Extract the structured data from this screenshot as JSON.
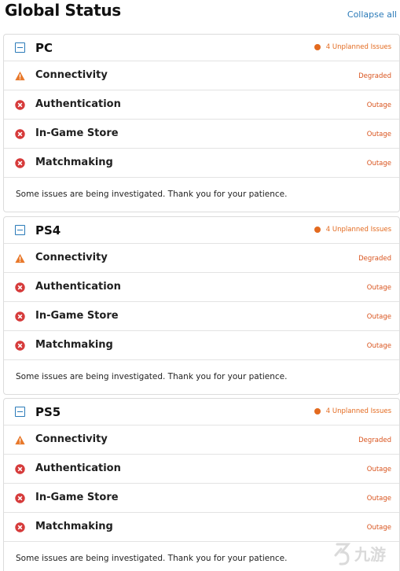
{
  "header": {
    "title": "Global Status",
    "collapse_all": "Collapse all"
  },
  "platforms": [
    {
      "name": "PC",
      "issues": "4 Unplanned Issues",
      "services": [
        {
          "name": "Connectivity",
          "status": "Degraded",
          "icon": "warning-icon"
        },
        {
          "name": "Authentication",
          "status": "Outage",
          "icon": "error-icon"
        },
        {
          "name": "In-Game Store",
          "status": "Outage",
          "icon": "error-icon"
        },
        {
          "name": "Matchmaking",
          "status": "Outage",
          "icon": "error-icon"
        }
      ],
      "note": "Some issues are being investigated. Thank you for your patience."
    },
    {
      "name": "PS4",
      "issues": "4 Unplanned Issues",
      "services": [
        {
          "name": "Connectivity",
          "status": "Degraded",
          "icon": "warning-icon"
        },
        {
          "name": "Authentication",
          "status": "Outage",
          "icon": "error-icon"
        },
        {
          "name": "In-Game Store",
          "status": "Outage",
          "icon": "error-icon"
        },
        {
          "name": "Matchmaking",
          "status": "Outage",
          "icon": "error-icon"
        }
      ],
      "note": "Some issues are being investigated. Thank you for your patience."
    },
    {
      "name": "PS5",
      "issues": "4 Unplanned Issues",
      "services": [
        {
          "name": "Connectivity",
          "status": "Degraded",
          "icon": "warning-icon"
        },
        {
          "name": "Authentication",
          "status": "Outage",
          "icon": "error-icon"
        },
        {
          "name": "In-Game Store",
          "status": "Outage",
          "icon": "error-icon"
        },
        {
          "name": "Matchmaking",
          "status": "Outage",
          "icon": "error-icon"
        }
      ],
      "note": "Some issues are being investigated. Thank you for your patience."
    }
  ],
  "watermark": {
    "text": "九游"
  },
  "colors": {
    "accent": "#2a7ab8",
    "warning": "#e8782a",
    "error": "#d63b3b",
    "status_text": "#d9541e"
  }
}
